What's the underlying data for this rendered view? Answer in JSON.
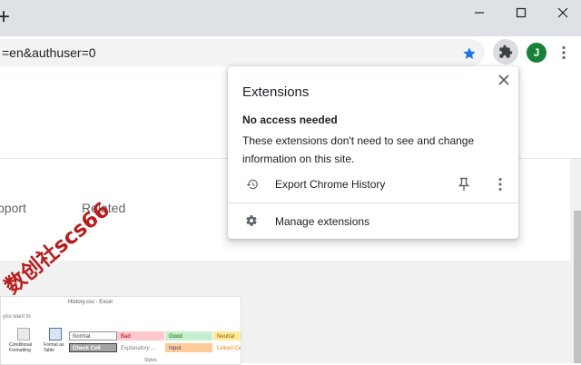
{
  "browser": {
    "new_tab_symbol": "+",
    "url": "=en&authuser=0",
    "avatar_letter": "J",
    "avatar_color": "#188038",
    "bookmark_star_color": "#1a73e8"
  },
  "page": {
    "tabs": [
      "pport",
      "Related"
    ]
  },
  "spreadsheet_preview": {
    "title": "History.csv - Excel",
    "ask_text": "you want to",
    "buttons": [
      "Conditional Formatting",
      "Format as Table"
    ],
    "styles": [
      {
        "label": "Normal",
        "color": "#ffffff"
      },
      {
        "label": "Bad",
        "color": "#ffc7ce"
      },
      {
        "label": "Good",
        "color": "#c6efce"
      },
      {
        "label": "Neutral",
        "color": "#ffeb9c"
      },
      {
        "label": "Check Cell",
        "color": "#a5a5a5"
      },
      {
        "label": "Explanatory ...",
        "color": "#ffffff"
      },
      {
        "label": "Input",
        "color": "#ffcc99"
      },
      {
        "label": "Linked Ce",
        "color": "#ffffff"
      }
    ],
    "footer": "Styles"
  },
  "watermark": "数创社scs66",
  "extensions_popup": {
    "title": "Extensions",
    "section_heading": "No access needed",
    "section_description": "These extensions don't need to see and change information on this site.",
    "extensions": [
      {
        "name": "Export Chrome History",
        "icon": "history-icon"
      }
    ],
    "manage_label": "Manage extensions"
  }
}
